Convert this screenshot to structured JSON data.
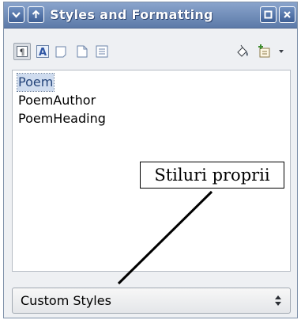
{
  "window": {
    "title": "Styles and Formatting"
  },
  "toolbar": {
    "icons": [
      "paragraph-styles-icon",
      "character-styles-icon",
      "frame-styles-icon",
      "page-styles-icon",
      "list-styles-icon",
      "fill-format-mode-icon",
      "new-style-from-selection-icon",
      "update-style-dropdown-icon"
    ]
  },
  "styles_list": {
    "items": [
      "Poem",
      "PoemAuthor",
      "PoemHeading"
    ],
    "selected": "Poem"
  },
  "annotation": {
    "label": "Stiluri proprii"
  },
  "filter": {
    "selected": "Custom Styles"
  },
  "colors": {
    "titlebar": "#5c7aa8",
    "selection": "#cfdcef"
  }
}
